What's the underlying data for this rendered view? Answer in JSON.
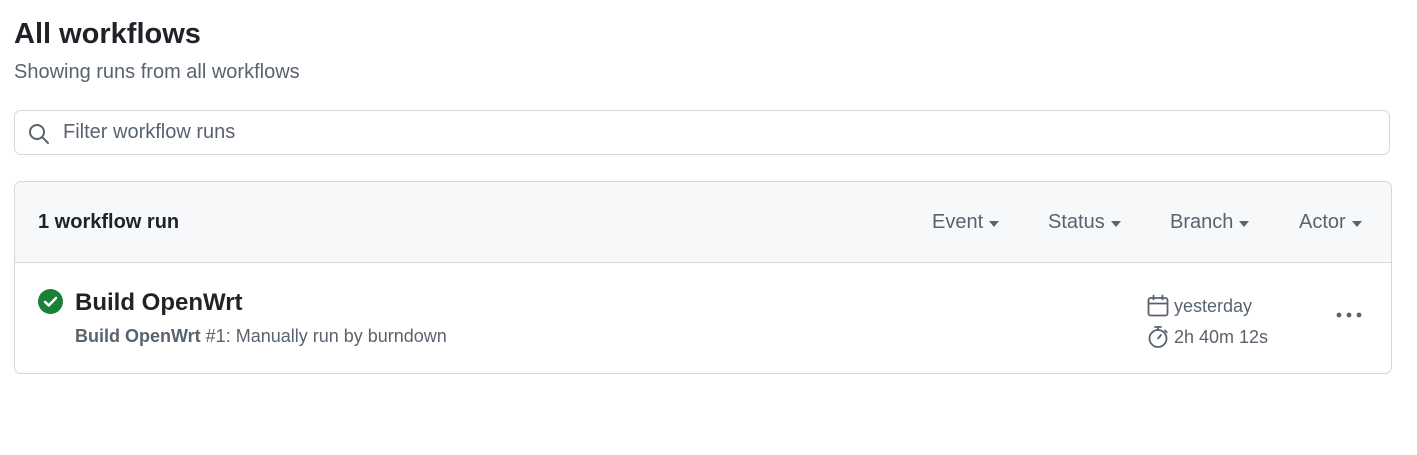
{
  "header": {
    "title": "All workflows",
    "subtitle": "Showing runs from all workflows"
  },
  "search": {
    "placeholder": "Filter workflow runs",
    "value": "",
    "icon": "search-icon"
  },
  "runs_list": {
    "count_label": "1 workflow run",
    "filters": [
      {
        "label": "Event",
        "icon": "caret-down-icon"
      },
      {
        "label": "Status",
        "icon": "caret-down-icon"
      },
      {
        "label": "Branch",
        "icon": "caret-down-icon"
      },
      {
        "label": "Actor",
        "icon": "caret-down-icon"
      }
    ],
    "runs": [
      {
        "status": "success",
        "status_icon": "check-circle-fill-icon",
        "title": "Build OpenWrt",
        "workflow_name": "Build OpenWrt",
        "meta_rest": " #1: Manually run by burndown",
        "date": "yesterday",
        "date_icon": "calendar-icon",
        "duration": "2h 40m 12s",
        "duration_icon": "stopwatch-icon",
        "menu_icon": "kebab-horizontal-icon"
      }
    ]
  },
  "colors": {
    "success": "#1a7f37",
    "text_primary": "#1f2328",
    "text_muted": "#59636e",
    "border": "#d1d9e0",
    "header_bg": "#f6f8fa"
  }
}
